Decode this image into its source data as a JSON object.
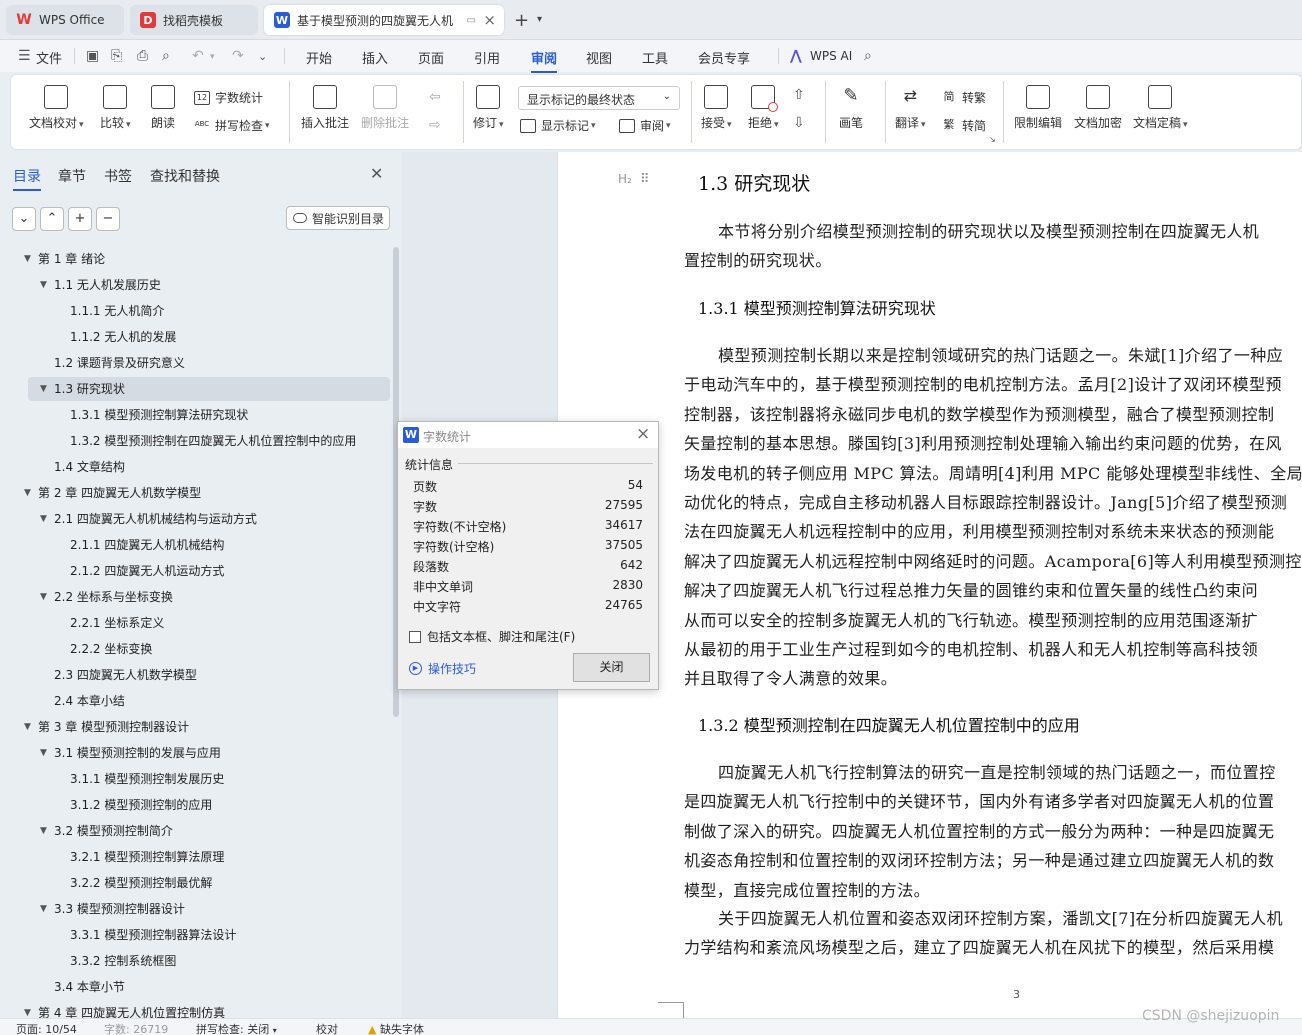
{
  "tabs": [
    {
      "label": "WPS Office",
      "logo": "W",
      "logo_color": "#e23a3a"
    },
    {
      "label": "找稻壳模板",
      "logo": "D",
      "logo_color": "#e23a3a"
    },
    {
      "label": "基于模型预测的四旋翼无人机",
      "logo": "W",
      "logo_color": "#2b5cd7"
    }
  ],
  "menu": {
    "file": "文件",
    "items": [
      "开始",
      "插入",
      "页面",
      "引用",
      "审阅",
      "视图",
      "工具",
      "会员专享"
    ],
    "active": "审阅",
    "ai": "WPS AI"
  },
  "ribbon": {
    "doc_check": "文档校对",
    "compare": "比较",
    "read_aloud": "朗读",
    "word_count": "字数统计",
    "spell_check": "拼写检查",
    "insert_comment": "插入批注",
    "delete_comment": "删除批注",
    "track_changes": "修订",
    "markup_select": "显示标记的最终状态",
    "show_markup": "显示标记",
    "review": "审阅",
    "accept": "接受",
    "reject": "拒绝",
    "ink": "画笔",
    "translate": "翻译",
    "to_traditional": "转繁",
    "to_simplified": "转简",
    "restrict_edit": "限制编辑",
    "encrypt": "文档加密",
    "finalize": "文档定稿"
  },
  "panel": {
    "tabs": [
      "目录",
      "章节",
      "书签",
      "查找和替换"
    ],
    "smart_toc": "智能识别目录",
    "toc": [
      {
        "label": "第 1 章  绪论",
        "level": 0,
        "expanded": true
      },
      {
        "label": "1.1 无人机发展历史",
        "level": 1,
        "expanded": true
      },
      {
        "label": "1.1.1  无人机简介",
        "level": 2
      },
      {
        "label": "1.1.2  无人机的发展",
        "level": 2
      },
      {
        "label": "1.2 课题背景及研究意义",
        "level": 1
      },
      {
        "label": "1.3 研究现状",
        "level": 1,
        "expanded": true,
        "selected": true
      },
      {
        "label": "1.3.1  模型预测控制算法研究现状",
        "level": 2
      },
      {
        "label": "1.3.2  模型预测控制在四旋翼无人机位置控制中的应用",
        "level": 2
      },
      {
        "label": "1.4  文章结构",
        "level": 1
      },
      {
        "label": "第 2 章  四旋翼无人机数学模型",
        "level": 0,
        "expanded": true
      },
      {
        "label": "2.1 四旋翼无人机机械结构与运动方式",
        "level": 1,
        "expanded": true
      },
      {
        "label": "2.1.1 四旋翼无人机机械结构",
        "level": 2
      },
      {
        "label": "2.1.2 四旋翼无人机运动方式",
        "level": 2
      },
      {
        "label": "2.2 坐标系与坐标变换",
        "level": 1,
        "expanded": true
      },
      {
        "label": "2.2.1 坐标系定义",
        "level": 2
      },
      {
        "label": "2.2.2 坐标变换",
        "level": 2
      },
      {
        "label": "2.3 四旋翼无人机数学模型",
        "level": 1
      },
      {
        "label": "2.4 本章小结",
        "level": 1
      },
      {
        "label": "第 3 章  模型预测控制器设计",
        "level": 0,
        "expanded": true
      },
      {
        "label": "3.1 模型预测控制的发展与应用",
        "level": 1,
        "expanded": true
      },
      {
        "label": "3.1.1 模型预测控制发展历史",
        "level": 2
      },
      {
        "label": "3.1.2 模型预测控制的应用",
        "level": 2
      },
      {
        "label": "3.2 模型预测控制简介",
        "level": 1,
        "expanded": true
      },
      {
        "label": "3.2.1 模型预测控制算法原理",
        "level": 2
      },
      {
        "label": "3.2.2 模型预测控制最优解",
        "level": 2
      },
      {
        "label": "3.3 模型预测控制器设计",
        "level": 1,
        "expanded": true
      },
      {
        "label": "3.3.1 模型预测控制器算法设计",
        "level": 2
      },
      {
        "label": "3.3.2 控制系统框图",
        "level": 2
      },
      {
        "label": "3.4 本章小节",
        "level": 1
      },
      {
        "label": "第 4 章  四旋翼无人机位置控制仿真",
        "level": 0,
        "expanded": true
      }
    ]
  },
  "doc": {
    "h2_marker": "H₂",
    "h2": "1.3 研究现状",
    "para1": [
      "本节将分别介绍模型预测控制的研究现状以及模型预测控制在四旋翼无人机",
      "置控制的研究现状。"
    ],
    "h3a": "1.3.1  模型预测控制算法研究现状",
    "para2": [
      "模型预测控制长期以来是控制领域研究的热门话题之一。朱斌[1]介绍了一种应",
      "于电动汽车中的，基于模型预测控制的电机控制方法。孟月[2]设计了双闭环模型预",
      "控制器，该控制器将永磁同步电机的数学模型作为预测模型，融合了模型预测控制",
      "矢量控制的基本思想。滕国钧[3]利用预测控制处理输入输出约束问题的优势，在风",
      "场发电机的转子侧应用 MPC 算法。周靖明[4]利用 MPC 能够处理模型非线性、全局",
      "动优化的特点，完成自主移动机器人目标跟踪控制器设计。Jang[5]介绍了模型预测",
      "法在四旋翼无人机远程控制中的应用，利用模型预测控制对系统未来状态的预测能",
      "解决了四旋翼无人机远程控制中网络延时的问题。Acampora[6]等人利用模型预测控",
      "解决了四旋翼无人机飞行过程总推力矢量的圆锥约束和位置矢量的线性凸约束问",
      "从而可以安全的控制多旋翼无人机的飞行轨迹。模型预测控制的应用范围逐渐扩",
      "从最初的用于工业生产过程到如今的电机控制、机器人和无人机控制等高科技领",
      "并且取得了令人满意的效果。"
    ],
    "h3b": "1.3.2  模型预测控制在四旋翼无人机位置控制中的应用",
    "para3": [
      "四旋翼无人机飞行控制算法的研究一直是控制领域的热门话题之一，而位置控",
      "是四旋翼无人机飞行控制中的关键环节，国内外有诸多学者对四旋翼无人机的位置",
      "制做了深入的研究。四旋翼无人机位置控制的方式一般分为两种：一种是四旋翼无",
      "机姿态角控制和位置控制的双闭环控制方法；另一种是通过建立四旋翼无人机的数",
      "模型，直接完成位置控制的方法。"
    ],
    "para4": [
      "关于四旋翼无人机位置和姿态双闭环控制方案，潘凯文[7]在分析四旋翼无人机",
      "力学结构和紊流风场模型之后，建立了四旋翼无人机在风扰下的模型，然后采用模"
    ],
    "page_number": "3"
  },
  "dialog": {
    "title": "字数统计",
    "section": "统计信息",
    "rows": [
      {
        "label": "页数",
        "value": "54"
      },
      {
        "label": "字数",
        "value": "27595"
      },
      {
        "label": "字符数(不计空格)",
        "value": "34617"
      },
      {
        "label": "字符数(计空格)",
        "value": "37505"
      },
      {
        "label": "段落数",
        "value": "642"
      },
      {
        "label": "非中文单词",
        "value": "2830"
      },
      {
        "label": "中文字符",
        "value": "24765"
      }
    ],
    "checkbox": "包括文本框、脚注和尾注(F)",
    "tips": "操作技巧",
    "close": "关闭"
  },
  "status": {
    "page": "页面: 10/54",
    "words": "字数: 26719",
    "spell": "拼写检查: 关闭",
    "proof": "校对",
    "missing_font": "缺失字体"
  },
  "watermark": "CSDN @shejizuopin"
}
